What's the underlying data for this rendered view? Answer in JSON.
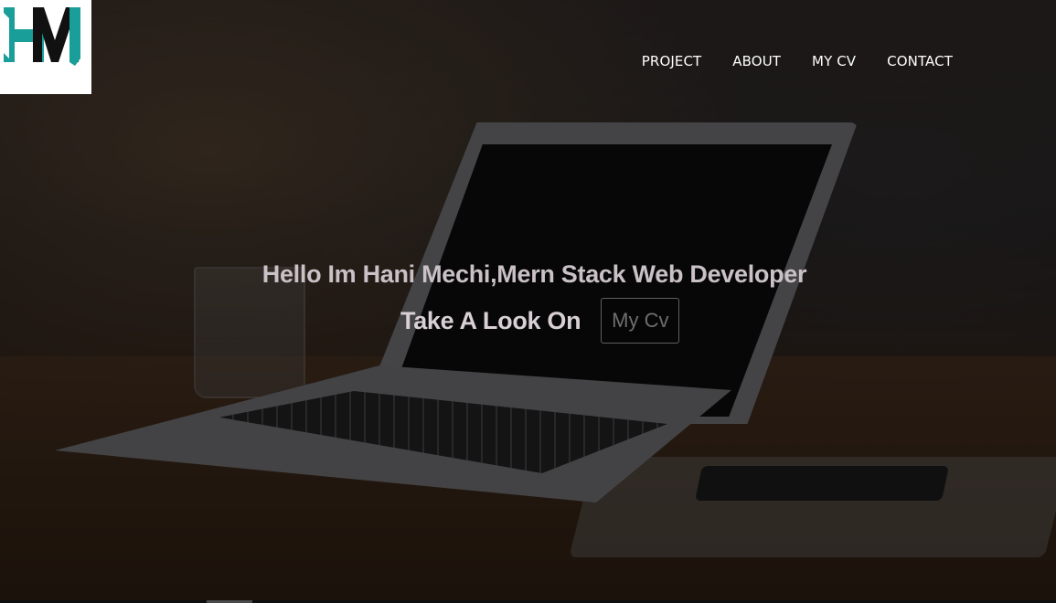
{
  "logo": {
    "text": "HM",
    "icon": "hm-logo-icon",
    "colors": {
      "teal": "#1a9e9a",
      "dark": "#111111"
    }
  },
  "nav": {
    "items": [
      {
        "label": "PROJECT"
      },
      {
        "label": "ABOUT"
      },
      {
        "label": "MY CV"
      },
      {
        "label": "CONTACT"
      }
    ]
  },
  "hero": {
    "headline": "Hello Im Hani Mechi,Mern Stack Web Developer",
    "subline": "Take A Look On",
    "cv_button": "My Cv"
  }
}
